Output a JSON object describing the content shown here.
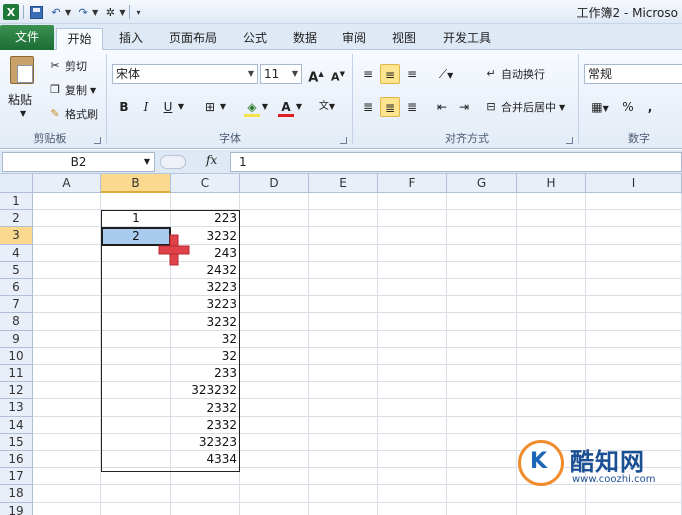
{
  "window": {
    "title": "工作簿2 - Microso"
  },
  "tabs": [
    {
      "label": "文件"
    },
    {
      "label": "开始"
    },
    {
      "label": "插入"
    },
    {
      "label": "页面布局"
    },
    {
      "label": "公式"
    },
    {
      "label": "数据"
    },
    {
      "label": "审阅"
    },
    {
      "label": "视图"
    },
    {
      "label": "开发工具"
    }
  ],
  "ribbon": {
    "clipboard": {
      "paste": "粘贴",
      "cut": "剪切",
      "copy": "复制",
      "format_painter": "格式刷",
      "label": "剪贴板"
    },
    "font": {
      "name": "宋体",
      "size": "11",
      "grow": "A",
      "shrink": "A",
      "bold": "B",
      "italic": "I",
      "underline": "U",
      "color_letter": "A",
      "label": "字体"
    },
    "alignment": {
      "wrap": "自动换行",
      "merge": "合并后居中",
      "label": "对齐方式"
    },
    "number": {
      "format": "常规",
      "percent": "%",
      "comma": ",",
      "label": "数字"
    }
  },
  "formula_bar": {
    "name_box": "B2",
    "fx": "fx",
    "value": "1"
  },
  "columns": [
    "A",
    "B",
    "C",
    "D",
    "E",
    "F",
    "G",
    "H",
    "I"
  ],
  "rows": [
    "1",
    "2",
    "3",
    "4",
    "5",
    "6",
    "7",
    "8",
    "9",
    "10",
    "11",
    "12",
    "13",
    "14",
    "15",
    "16",
    "17",
    "18",
    "19"
  ],
  "cells": {
    "B": [
      "",
      "1",
      "2",
      "",
      "",
      "",
      "",
      "",
      "",
      "",
      "",
      "",
      "",
      "",
      "",
      "",
      "",
      "",
      ""
    ],
    "C": [
      "",
      "223",
      "3232",
      "243",
      "2432",
      "3223",
      "3223",
      "3232",
      "32",
      "32",
      "233",
      "323232",
      "2332",
      "2332",
      "32323",
      "4334",
      "",
      "",
      ""
    ]
  },
  "watermark": {
    "title": "酷知网",
    "url": "www.coozhi.com"
  },
  "colors": {
    "file_tab": "#1c6d35",
    "selection": "#a8cbee",
    "header_selected": "#fbd98e",
    "cursor": "#e0424a"
  }
}
